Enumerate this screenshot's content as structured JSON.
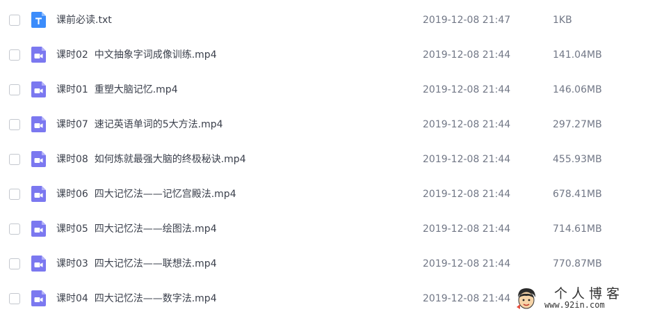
{
  "files": [
    {
      "name": "课前必读.txt",
      "date": "2019-12-08 21:47",
      "size": "1KB",
      "icon": "text-file-icon",
      "icon_color": "#3b8cfb"
    },
    {
      "name": "课时02  中文抽象字词成像训练.mp4",
      "date": "2019-12-08 21:44",
      "size": "141.04MB",
      "icon": "video-file-icon",
      "icon_color": "#7b78f0"
    },
    {
      "name": "课时01  重塑大脑记忆.mp4",
      "date": "2019-12-08 21:44",
      "size": "146.06MB",
      "icon": "video-file-icon",
      "icon_color": "#7b78f0"
    },
    {
      "name": "课时07  速记英语单词的5大方法.mp4",
      "date": "2019-12-08 21:44",
      "size": "297.27MB",
      "icon": "video-file-icon",
      "icon_color": "#7b78f0"
    },
    {
      "name": "课时08  如何炼就最强大脑的终极秘诀.mp4",
      "date": "2019-12-08 21:44",
      "size": "455.93MB",
      "icon": "video-file-icon",
      "icon_color": "#7b78f0"
    },
    {
      "name": "课时06  四大记忆法——记忆宫殿法.mp4",
      "date": "2019-12-08 21:44",
      "size": "678.41MB",
      "icon": "video-file-icon",
      "icon_color": "#7b78f0"
    },
    {
      "name": "课时05  四大记忆法——绘图法.mp4",
      "date": "2019-12-08 21:44",
      "size": "714.61MB",
      "icon": "video-file-icon",
      "icon_color": "#7b78f0"
    },
    {
      "name": "课时03  四大记忆法——联想法.mp4",
      "date": "2019-12-08 21:44",
      "size": "770.87MB",
      "icon": "video-file-icon",
      "icon_color": "#7b78f0"
    },
    {
      "name": "课时04  四大记忆法——数字法.mp4",
      "date": "2019-12-08 21:44",
      "size": "",
      "icon": "video-file-icon",
      "icon_color": "#7b78f0"
    }
  ],
  "watermark": {
    "title": "个人博客",
    "url": "www.92in.com"
  }
}
